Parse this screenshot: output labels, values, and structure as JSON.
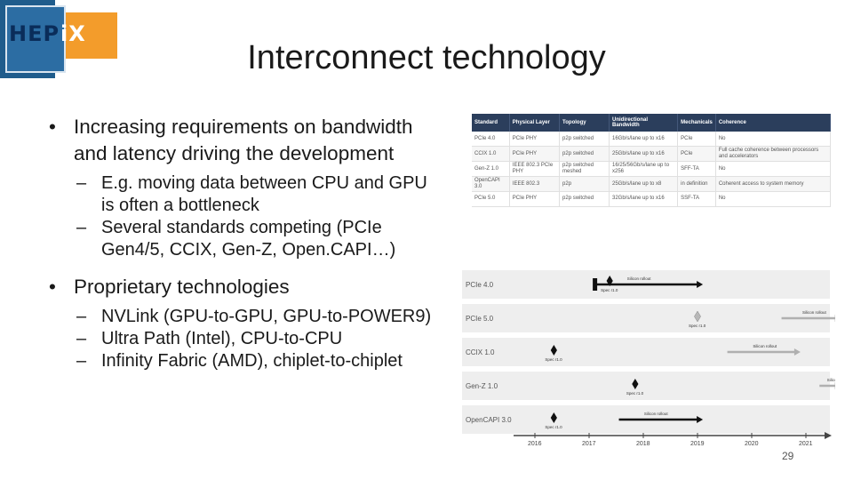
{
  "logo": {
    "part1": "HEP",
    "part2": "iX"
  },
  "title": "Interconnect technology",
  "bullets": [
    {
      "level": 1,
      "text": "Increasing requirements on bandwidth and latency driving the development",
      "lines": [
        "Increasing requirements on bandwidth",
        "and latency driving the development"
      ]
    },
    {
      "level": 2,
      "lines": [
        "E.g. moving data between CPU and GPU",
        "is often a bottleneck"
      ]
    },
    {
      "level": 2,
      "lines": [
        "Several standards competing (PCIe",
        "Gen4/5, CCIX, Gen-Z, Open.CAPI…)"
      ]
    },
    {
      "level": 1,
      "lines": [
        "Proprietary technologies"
      ]
    },
    {
      "level": 2,
      "lines": [
        "NVLink (GPU-to-GPU, GPU-to-POWER9)"
      ]
    },
    {
      "level": 2,
      "lines": [
        "Ultra Path (Intel), CPU-to-CPU"
      ]
    },
    {
      "level": 2,
      "lines": [
        "Infinity Fabric (AMD), chiplet-to-chiplet"
      ]
    }
  ],
  "bullet_glyph": "•",
  "dash_glyph": "–",
  "table": {
    "headers": [
      "Standard",
      "Physical Layer",
      "Topology",
      "Unidirectional Bandwidth",
      "Mechanicals",
      "Coherence"
    ],
    "rows": [
      [
        "PCIe 4.0",
        "PCIe PHY",
        "p2p switched",
        "16Gb/s/lane up to x16",
        "PCIe",
        "No"
      ],
      [
        "CCIX 1.0",
        "PCIe PHY",
        "p2p switched",
        "25Gb/s/lane up to x16",
        "PCIe",
        "Full cache coherence between processors and accelerators"
      ],
      [
        "Gen-Z 1.0",
        "IEEE 802.3 PCIe PHY",
        "p2p switched meshed",
        "16/25/56Gb/s/lane up to x256",
        "SFF-TA",
        "No"
      ],
      [
        "OpenCAPI 3.0",
        "IEEE 802.3",
        "p2p",
        "25Gb/s/lane up to x8",
        "in definition",
        "Coherent access to system memory"
      ],
      [
        "PCIe 5.0",
        "PCIe PHY",
        "p2p switched",
        "32Gb/s/lane up to x16",
        "SSF-TA",
        "No"
      ]
    ]
  },
  "timeline": {
    "years": [
      "2016",
      "2017",
      "2018",
      "2019",
      "2020",
      "2021"
    ],
    "rows": [
      {
        "name": "PCIe 4.0",
        "spec_label": "Spec r1.0",
        "spec_year": 2017.38,
        "spec_style": "dark",
        "rollout_label": "Silicon rollout",
        "rollout_start": 2017.1,
        "rollout_end": 2019.1,
        "rollout_style": "dark",
        "marker_start": true
      },
      {
        "name": "PCIe 5.0",
        "spec_label": "Spec r1.0",
        "spec_year": 2019.0,
        "spec_style": "light",
        "rollout_label": "Silicon rollout",
        "rollout_start": 2020.55,
        "rollout_end": 2021.65,
        "rollout_style": "light",
        "marker_start": false
      },
      {
        "name": "CCIX 1.0",
        "spec_label": "Spec r1.0",
        "spec_year": 2016.35,
        "spec_style": "dark",
        "rollout_label": "Silicon rollout",
        "rollout_start": 2019.55,
        "rollout_end": 2020.9,
        "rollout_style": "light",
        "marker_start": false
      },
      {
        "name": "Gen-Z 1.0",
        "spec_label": "Spec r1.0",
        "spec_year": 2017.85,
        "spec_style": "dark",
        "rollout_label": "Silicon rollout",
        "rollout_start": 2021.25,
        "rollout_end": 2021.65,
        "rollout_style": "light",
        "marker_start": false
      },
      {
        "name": "OpenCAPI 3.0",
        "spec_label": "Spec r1.0",
        "spec_year": 2016.35,
        "spec_style": "dark",
        "rollout_label": "Silicon rollout",
        "rollout_start": 2017.55,
        "rollout_end": 2019.1,
        "rollout_style": "dark",
        "marker_start": false
      }
    ]
  },
  "page_number": "29"
}
